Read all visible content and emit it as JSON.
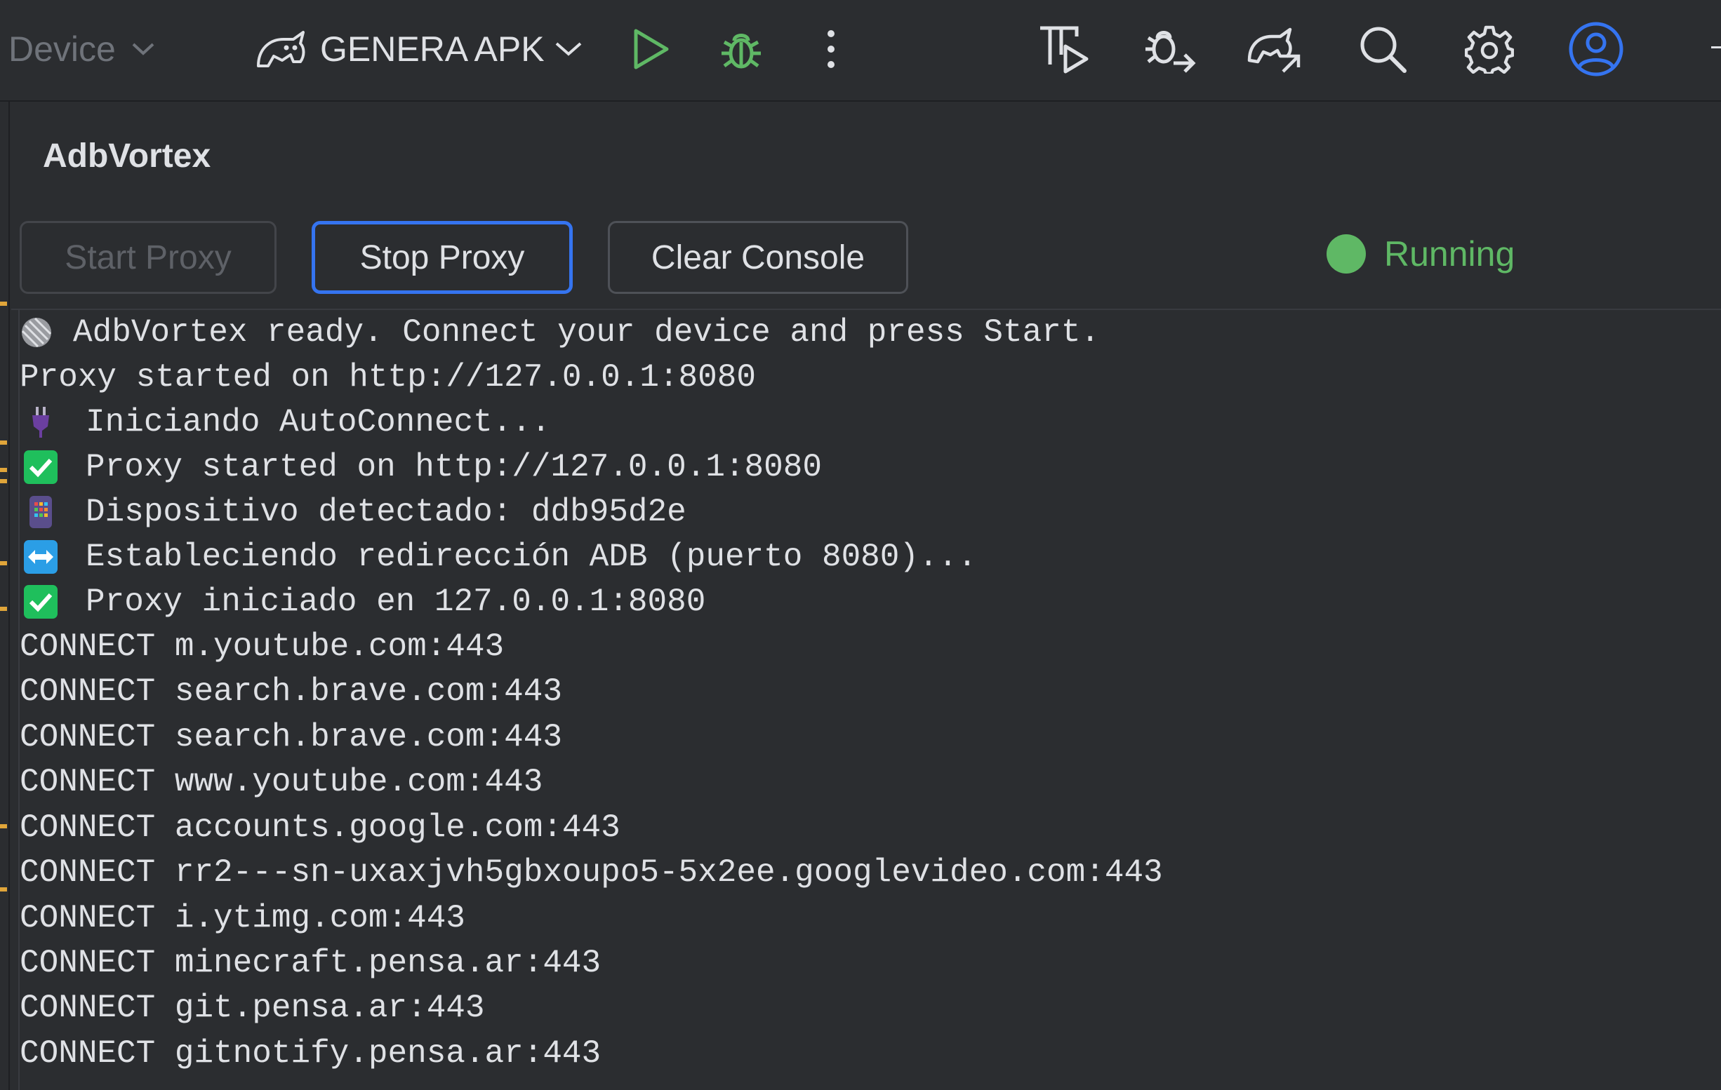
{
  "toolbar": {
    "device_label": "Device",
    "config_label": "GENERA APK",
    "icons": [
      "android-config-icon",
      "run-icon",
      "debug-icon",
      "more-icon",
      "profiler-icon",
      "attach-debugger-icon",
      "apply-changes-icon",
      "search-icon",
      "settings-icon",
      "account-icon"
    ],
    "colors": {
      "run": "#5fb865",
      "debug": "#5fb865",
      "account": "#3574f0"
    }
  },
  "panel": {
    "title": "AdbVortex",
    "buttons": {
      "start": "Start Proxy",
      "stop": "Stop Proxy",
      "clear": "Clear Console"
    },
    "status": {
      "text": "Running",
      "color": "#5fb865"
    }
  },
  "console": {
    "lines": [
      {
        "icon": "globe-icon",
        "text": "AdbVortex ready. Connect your device and press Start."
      },
      {
        "icon": null,
        "text": "Proxy started on http://127.0.0.1:8080"
      },
      {
        "icon": "plug-icon",
        "text": "Iniciando AutoConnect..."
      },
      {
        "icon": "check-icon",
        "text": "Proxy started on http://127.0.0.1:8080"
      },
      {
        "icon": "phone-icon",
        "text": "Dispositivo detectado: ddb95d2e"
      },
      {
        "icon": "left-right-arrow-icon",
        "text": "Estableciendo redirección ADB (puerto 8080)..."
      },
      {
        "icon": "check-icon",
        "text": "Proxy iniciado en 127.0.0.1:8080"
      },
      {
        "icon": null,
        "text": "CONNECT m.youtube.com:443"
      },
      {
        "icon": null,
        "text": "CONNECT search.brave.com:443"
      },
      {
        "icon": null,
        "text": "CONNECT search.brave.com:443"
      },
      {
        "icon": null,
        "text": "CONNECT www.youtube.com:443"
      },
      {
        "icon": null,
        "text": "CONNECT accounts.google.com:443"
      },
      {
        "icon": null,
        "text": "CONNECT rr2---sn-uxaxjvh5gbxoupo5-5x2ee.googlevideo.com:443"
      },
      {
        "icon": null,
        "text": "CONNECT i.ytimg.com:443"
      },
      {
        "icon": null,
        "text": "CONNECT minecraft.pensa.ar:443"
      },
      {
        "icon": null,
        "text": "CONNECT git.pensa.ar:443"
      },
      {
        "icon": null,
        "text": "CONNECT gitnotify.pensa.ar:443"
      }
    ]
  }
}
